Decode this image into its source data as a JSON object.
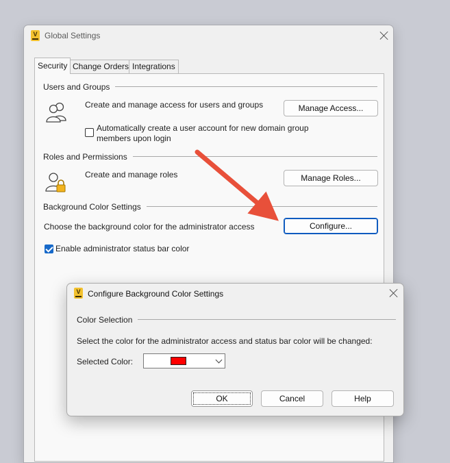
{
  "main_window": {
    "title": "Global Settings",
    "tabs": [
      {
        "label": "Security",
        "active": true
      },
      {
        "label": "Change Orders",
        "active": false
      },
      {
        "label": "Integrations",
        "active": false
      }
    ],
    "users_groups": {
      "title": "Users and Groups",
      "description": "Create and manage access for users and groups",
      "button": "Manage Access...",
      "checkbox_line1": "Automatically create a user account for new domain group",
      "checkbox_line2": "members upon login",
      "checkbox_checked": false
    },
    "roles_permissions": {
      "title": "Roles and Permissions",
      "description": "Create and manage roles",
      "button": "Manage Roles..."
    },
    "background_color": {
      "title": "Background Color Settings",
      "description": "Choose the background color for the administrator access",
      "button": "Configure...",
      "checkbox_label": "Enable administrator status bar color",
      "checkbox_checked": true
    }
  },
  "dialog": {
    "title": "Configure Background Color Settings",
    "group_title": "Color Selection",
    "instruction": "Select the color for the administrator access and status bar color will be changed:",
    "selected_label": "Selected Color:",
    "selected_color": "#ff0000",
    "ok": "OK",
    "cancel": "Cancel",
    "help": "Help"
  },
  "colors": {
    "accent": "#1769c9",
    "annotation_arrow": "#e8503a"
  }
}
